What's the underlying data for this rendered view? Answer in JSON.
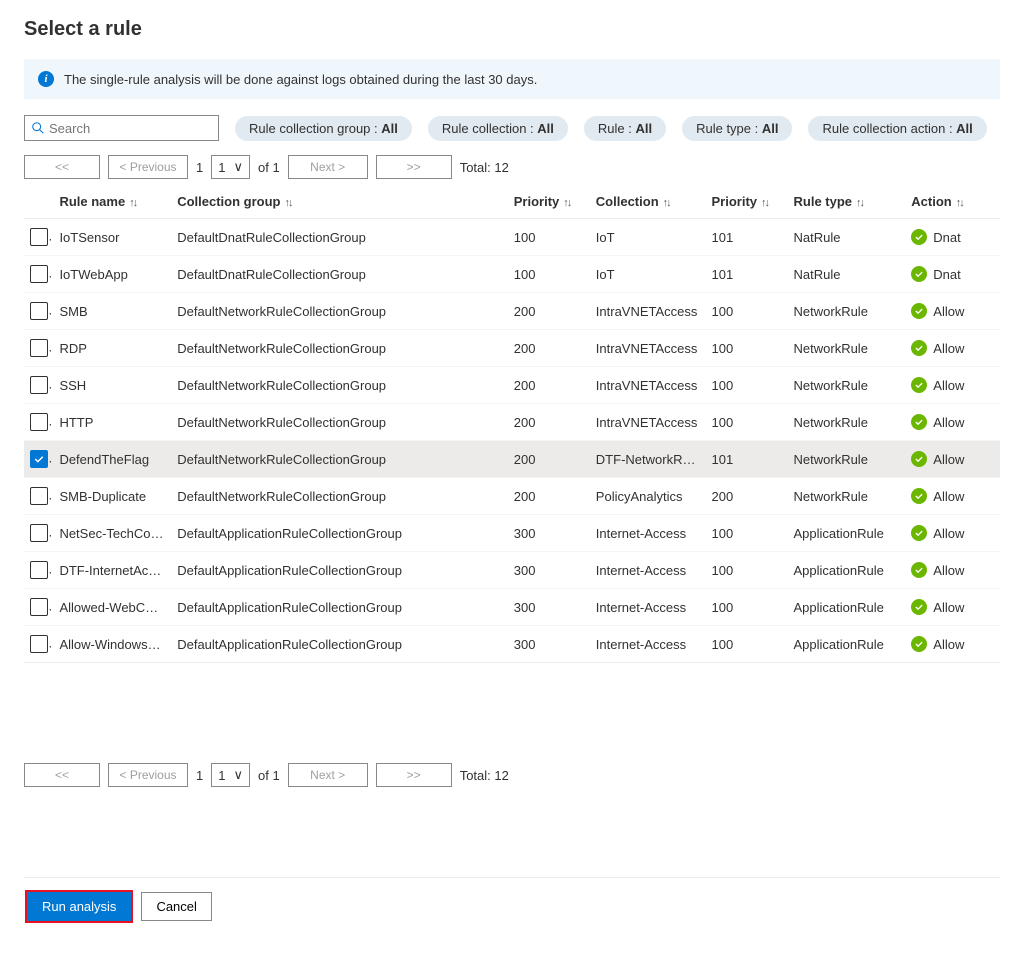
{
  "title": "Select a rule",
  "banner": {
    "icon": "i",
    "text": "The single-rule analysis will be done against logs obtained during the last 30 days."
  },
  "search": {
    "placeholder": "Search"
  },
  "filters": [
    {
      "label": "Rule collection group : ",
      "value": "All"
    },
    {
      "label": "Rule collection : ",
      "value": "All"
    },
    {
      "label": "Rule : ",
      "value": "All"
    },
    {
      "label": "Rule type : ",
      "value": "All"
    },
    {
      "label": "Rule collection action : ",
      "value": "All"
    }
  ],
  "pager": {
    "first": "<<",
    "prev": "< Previous",
    "page_current": "1",
    "page_of_prefix": "of ",
    "page_total": "1",
    "next": "Next >",
    "last": ">>",
    "total_label": "Total: ",
    "total_value": "12"
  },
  "columns": {
    "rule_name": "Rule name",
    "collection_group": "Collection group",
    "priority": "Priority",
    "collection": "Collection",
    "priority2": "Priority",
    "rule_type": "Rule type",
    "action": "Action"
  },
  "rows": [
    {
      "checked": false,
      "name": "IoTSensor",
      "group": "DefaultDnatRuleCollectionGroup",
      "pri1": "100",
      "coll": "IoT",
      "pri2": "101",
      "type": "NatRule",
      "action": "Dnat"
    },
    {
      "checked": false,
      "name": "IoTWebApp",
      "group": "DefaultDnatRuleCollectionGroup",
      "pri1": "100",
      "coll": "IoT",
      "pri2": "101",
      "type": "NatRule",
      "action": "Dnat"
    },
    {
      "checked": false,
      "name": "SMB",
      "group": "DefaultNetworkRuleCollectionGroup",
      "pri1": "200",
      "coll": "IntraVNETAccess",
      "pri2": "100",
      "type": "NetworkRule",
      "action": "Allow"
    },
    {
      "checked": false,
      "name": "RDP",
      "group": "DefaultNetworkRuleCollectionGroup",
      "pri1": "200",
      "coll": "IntraVNETAccess",
      "pri2": "100",
      "type": "NetworkRule",
      "action": "Allow"
    },
    {
      "checked": false,
      "name": "SSH",
      "group": "DefaultNetworkRuleCollectionGroup",
      "pri1": "200",
      "coll": "IntraVNETAccess",
      "pri2": "100",
      "type": "NetworkRule",
      "action": "Allow"
    },
    {
      "checked": false,
      "name": "HTTP",
      "group": "DefaultNetworkRuleCollectionGroup",
      "pri1": "200",
      "coll": "IntraVNETAccess",
      "pri2": "100",
      "type": "NetworkRule",
      "action": "Allow"
    },
    {
      "checked": true,
      "name": "DefendTheFlag",
      "group": "DefaultNetworkRuleCollectionGroup",
      "pri1": "200",
      "coll": "DTF-NetworkR…",
      "pri2": "101",
      "type": "NetworkRule",
      "action": "Allow"
    },
    {
      "checked": false,
      "name": "SMB-Duplicate",
      "group": "DefaultNetworkRuleCollectionGroup",
      "pri1": "200",
      "coll": "PolicyAnalytics",
      "pri2": "200",
      "type": "NetworkRule",
      "action": "Allow"
    },
    {
      "checked": false,
      "name": "NetSec-TechCo…",
      "group": "DefaultApplicationRuleCollectionGroup",
      "pri1": "300",
      "coll": "Internet-Access",
      "pri2": "100",
      "type": "ApplicationRule",
      "action": "Allow"
    },
    {
      "checked": false,
      "name": "DTF-InternetAc…",
      "group": "DefaultApplicationRuleCollectionGroup",
      "pri1": "300",
      "coll": "Internet-Access",
      "pri2": "100",
      "type": "ApplicationRule",
      "action": "Allow"
    },
    {
      "checked": false,
      "name": "Allowed-WebC…",
      "group": "DefaultApplicationRuleCollectionGroup",
      "pri1": "300",
      "coll": "Internet-Access",
      "pri2": "100",
      "type": "ApplicationRule",
      "action": "Allow"
    },
    {
      "checked": false,
      "name": "Allow-Windows…",
      "group": "DefaultApplicationRuleCollectionGroup",
      "pri1": "300",
      "coll": "Internet-Access",
      "pri2": "100",
      "type": "ApplicationRule",
      "action": "Allow"
    }
  ],
  "footer": {
    "run": "Run analysis",
    "cancel": "Cancel"
  }
}
